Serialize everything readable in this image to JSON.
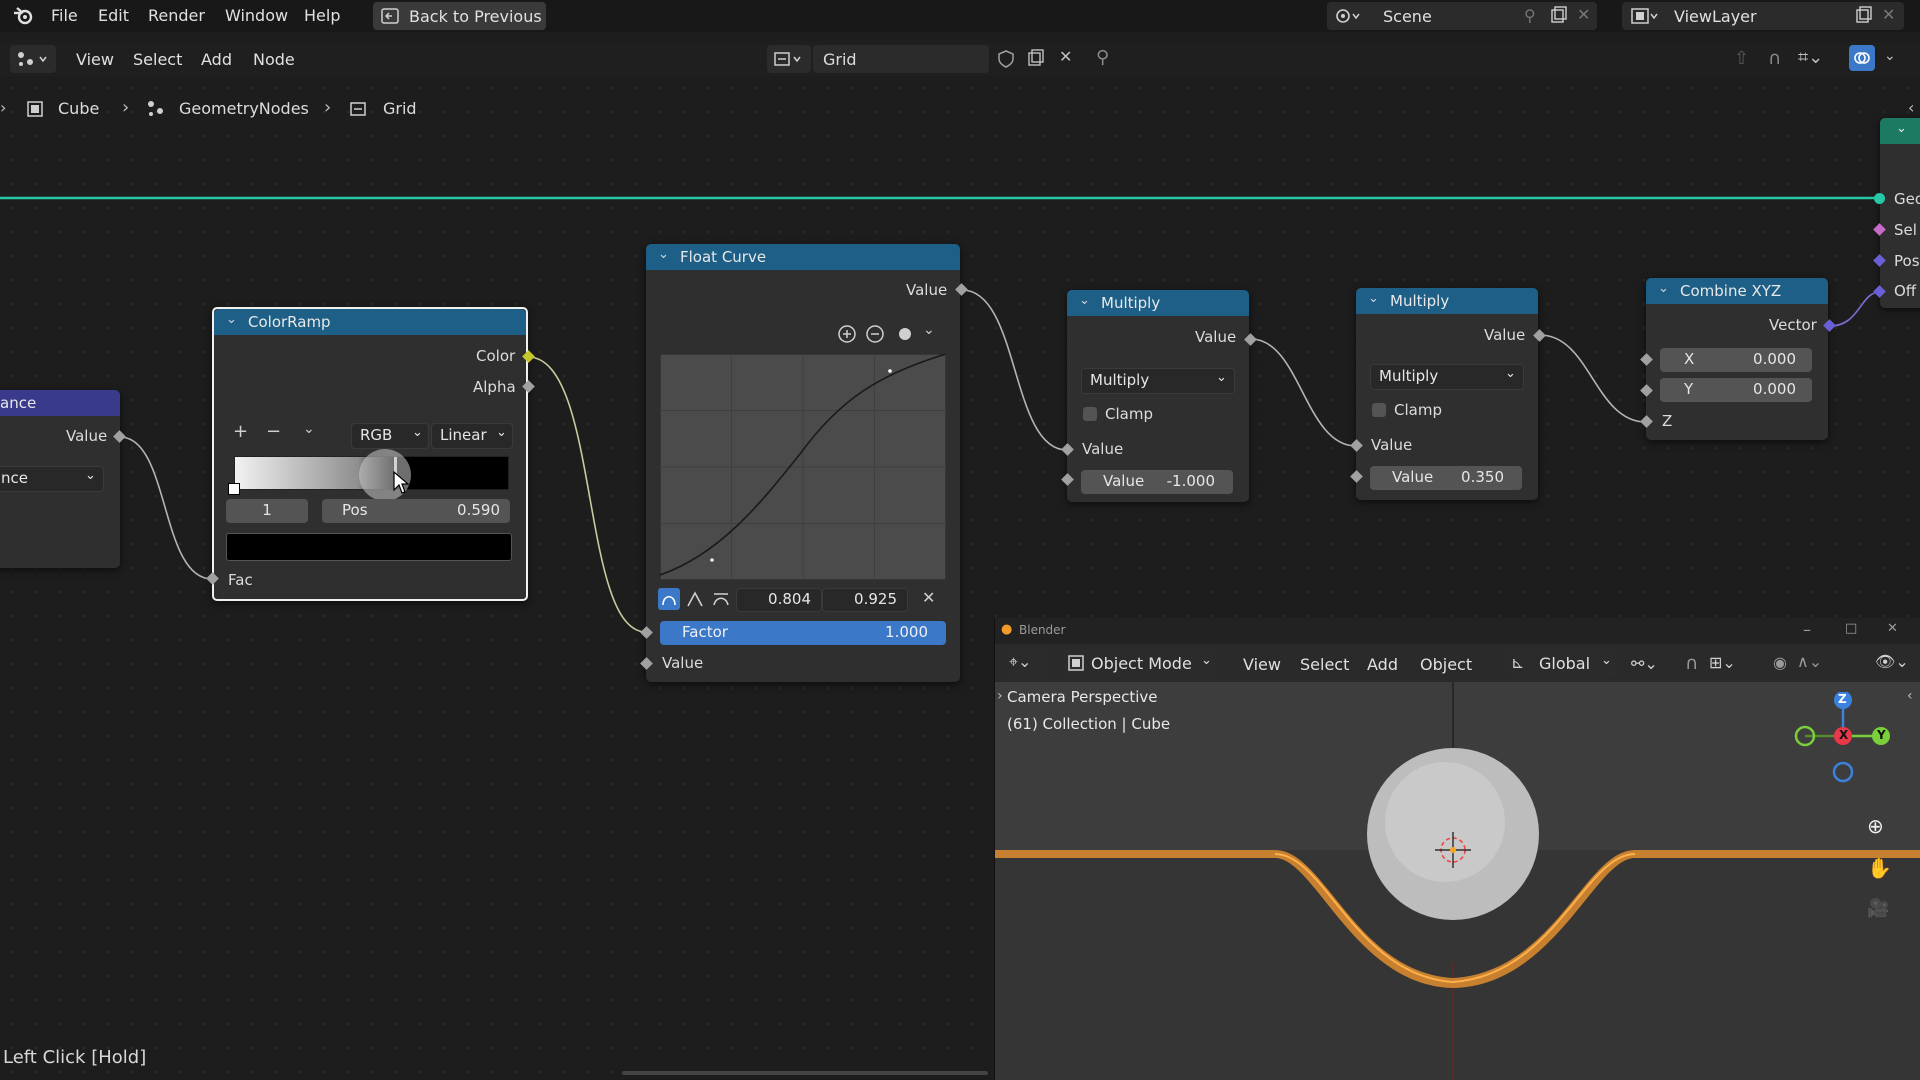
{
  "topbar": {
    "menus": [
      "File",
      "Edit",
      "Render",
      "Window",
      "Help"
    ],
    "back_label": "Back to Previous",
    "scene_label": "Scene",
    "viewlayer_label": "ViewLayer"
  },
  "editor_header": {
    "menus": [
      "View",
      "Select",
      "Add",
      "Node"
    ],
    "nodetree_name": "Grid"
  },
  "breadcrumb": {
    "items": [
      "Cube",
      "GeometryNodes",
      "Grid"
    ]
  },
  "nodes": {
    "left_partial": {
      "title": "ance",
      "output_label": "Value",
      "dropdown": "nce"
    },
    "colorramp": {
      "title": "ColorRamp",
      "outputs": [
        "Color",
        "Alpha"
      ],
      "mode": "RGB",
      "interpolation": "Linear",
      "stop_index": "1",
      "pos_label": "Pos",
      "pos_value": "0.590",
      "input_label": "Fac",
      "marker_position": 0.59
    },
    "float_curve": {
      "title": "Float Curve",
      "output_label": "Value",
      "point_x": "0.804",
      "point_y": "0.925",
      "factor_label": "Factor",
      "factor_value": "1.000",
      "input_label": "Value"
    },
    "multiply1": {
      "title": "Multiply",
      "output_label": "Value",
      "operation": "Multiply",
      "clamp_label": "Clamp",
      "input_label": "Value",
      "value_label": "Value",
      "value": "-1.000"
    },
    "multiply2": {
      "title": "Multiply",
      "output_label": "Value",
      "operation": "Multiply",
      "clamp_label": "Clamp",
      "input_label": "Value",
      "value_label": "Value",
      "value": "0.350"
    },
    "combine_xyz": {
      "title": "Combine XYZ",
      "output_label": "Vector",
      "x_label": "X",
      "x_value": "0.000",
      "y_label": "Y",
      "y_value": "0.000",
      "z_label": "Z"
    },
    "right_partial": {
      "sockets": [
        "Geo",
        "Sel",
        "Pos",
        "Off"
      ]
    }
  },
  "viewport": {
    "window_title": "Blender",
    "mode": "Object Mode",
    "menus": [
      "View",
      "Select",
      "Add",
      "Object"
    ],
    "transform_orientation": "Global",
    "overlay_line1": "Camera Perspective",
    "overlay_line2": "(61) Collection | Cube",
    "gizmo": {
      "z": "Z",
      "x": "X",
      "y": "Y"
    }
  },
  "status_bar": {
    "text": "Left Click [Hold]"
  },
  "colors": {
    "node_header": "#1d5f86",
    "link_geometry": "#27c8a8",
    "selection": "#f5a623",
    "accent_blue": "#3c78c8"
  }
}
